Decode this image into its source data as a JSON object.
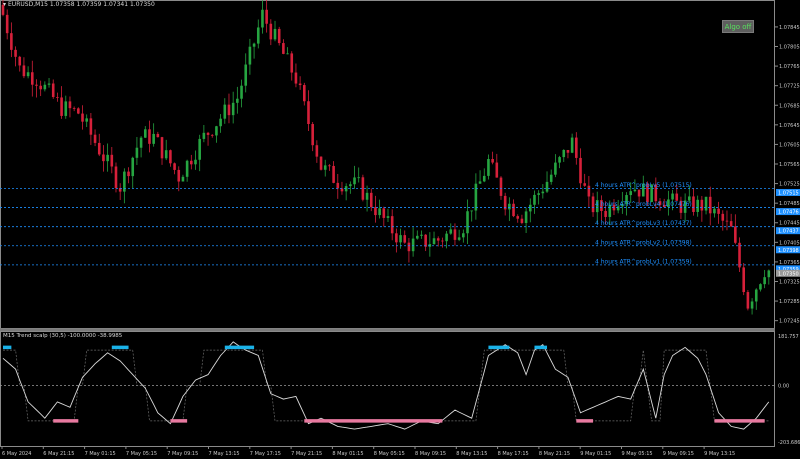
{
  "header": {
    "symbol_line": "EURUSD,M15  1.07358 1.07359 1.07341 1.07350"
  },
  "algo_button": {
    "label": "Algo off"
  },
  "indicator": {
    "title": "M15 Trend scalp (30,5) -100.0000 -38.9985",
    "scale_top": "181.757",
    "scale_zero": "0.00",
    "scale_bottom": "-203.6869"
  },
  "price_axis": {
    "range": [
      1.0723,
      1.079
    ],
    "ticks": [
      {
        "value": 1.07845,
        "label": "1.07845"
      },
      {
        "value": 1.07805,
        "label": "1.07805"
      },
      {
        "value": 1.07765,
        "label": "1.07765"
      },
      {
        "value": 1.07725,
        "label": "1.07725"
      },
      {
        "value": 1.07685,
        "label": "1.07685"
      },
      {
        "value": 1.07645,
        "label": "1.07645"
      },
      {
        "value": 1.07605,
        "label": "1.07605"
      },
      {
        "value": 1.07565,
        "label": "1.07565"
      },
      {
        "value": 1.07525,
        "label": "1.07525"
      },
      {
        "value": 1.07485,
        "label": "1.07485"
      },
      {
        "value": 1.07445,
        "label": "1.07445"
      },
      {
        "value": 1.07405,
        "label": "1.07405"
      },
      {
        "value": 1.07365,
        "label": "1.07365"
      },
      {
        "value": 1.07325,
        "label": "1.07325"
      },
      {
        "value": 1.07285,
        "label": "1.07285"
      },
      {
        "value": 1.07245,
        "label": "1.07245"
      }
    ]
  },
  "time_axis": [
    "6 May 2024",
    "6 May 21:15",
    "7 May 01:15",
    "7 May 05:15",
    "7 May 09:15",
    "7 May 13:15",
    "7 May 17:15",
    "7 May 21:15",
    "8 May 01:15",
    "8 May 05:15",
    "8 May 09:15",
    "8 May 13:15",
    "8 May 17:15",
    "8 May 21:15",
    "9 May 01:15",
    "9 May 05:15",
    "9 May 09:15",
    "9 May 13:15"
  ],
  "levels": [
    {
      "label": "4 hours ATR^probLv5 (1.07515)",
      "value": 1.07515,
      "tag": "1.07515"
    },
    {
      "label": "4 hours ATR^probLv4 (1.07476)",
      "value": 1.07476,
      "tag": "1.07476"
    },
    {
      "label": "4 hours ATR^probLv3 (1.07437)",
      "value": 1.07437,
      "tag": "1.07437"
    },
    {
      "label": "4 hours ATR^probLv2 (1.07398)",
      "value": 1.07398,
      "tag": "1.07398"
    },
    {
      "label": "4 hours ATR^probLv1 (1.07359)",
      "value": 1.07359,
      "tag": "1.07359"
    }
  ],
  "current_price": {
    "value": 1.0735,
    "tag": "1.07350"
  },
  "colors": {
    "bull": "#26a541",
    "bear": "#d6203a",
    "level": "#1e90ff",
    "osc_line": "#d9d9d9",
    "up_segment": "#1ab2e8",
    "down_segment": "#e87aa0",
    "background": "#000000"
  },
  "chart_data": {
    "type": "candlestick",
    "price_key_points": [
      [
        0,
        1.0787
      ],
      [
        4,
        1.0776
      ],
      [
        8,
        1.0774
      ],
      [
        14,
        1.0768
      ],
      [
        18,
        1.0767
      ],
      [
        24,
        1.0758
      ],
      [
        28,
        1.0752
      ],
      [
        33,
        1.0762
      ],
      [
        36,
        1.0762
      ],
      [
        42,
        1.0754
      ],
      [
        48,
        1.0762
      ],
      [
        56,
        1.077
      ],
      [
        62,
        1.0787
      ],
      [
        70,
        1.0774
      ],
      [
        76,
        1.0756
      ],
      [
        80,
        1.0753
      ],
      [
        85,
        1.0752
      ],
      [
        92,
        1.0744
      ],
      [
        96,
        1.074
      ],
      [
        104,
        1.0741
      ],
      [
        110,
        1.0744
      ],
      [
        116,
        1.0757
      ],
      [
        120,
        1.0749
      ],
      [
        124,
        1.0746
      ],
      [
        130,
        1.0753
      ],
      [
        136,
        1.0761
      ],
      [
        140,
        1.0748
      ],
      [
        144,
        1.0747
      ],
      [
        150,
        1.0752
      ],
      [
        156,
        1.075
      ],
      [
        162,
        1.0748
      ],
      [
        168,
        1.0748
      ],
      [
        174,
        1.0743
      ],
      [
        178,
        1.0728
      ],
      [
        182,
        1.0735
      ]
    ],
    "oscillator": {
      "range": [
        -203.6869,
        181.757
      ],
      "key_points": [
        [
          0,
          100
        ],
        [
          3,
          60
        ],
        [
          6,
          -60
        ],
        [
          10,
          -120
        ],
        [
          13,
          -60
        ],
        [
          16,
          -80
        ],
        [
          19,
          30
        ],
        [
          22,
          80
        ],
        [
          25,
          120
        ],
        [
          28,
          90
        ],
        [
          31,
          40
        ],
        [
          34,
          -10
        ],
        [
          37,
          -100
        ],
        [
          40,
          -140
        ],
        [
          43,
          -40
        ],
        [
          46,
          20
        ],
        [
          49,
          40
        ],
        [
          52,
          110
        ],
        [
          55,
          160
        ],
        [
          58,
          130
        ],
        [
          61,
          110
        ],
        [
          64,
          -30
        ],
        [
          67,
          -50
        ],
        [
          70,
          -40
        ],
        [
          73,
          -140
        ],
        [
          76,
          -120
        ],
        [
          80,
          -150
        ],
        [
          84,
          -160
        ],
        [
          88,
          -150
        ],
        [
          92,
          -140
        ],
        [
          96,
          -160
        ],
        [
          100,
          -130
        ],
        [
          104,
          -140
        ],
        [
          108,
          -90
        ],
        [
          112,
          -120
        ],
        [
          116,
          110
        ],
        [
          120,
          150
        ],
        [
          123,
          120
        ],
        [
          125,
          40
        ],
        [
          127,
          130
        ],
        [
          129,
          150
        ],
        [
          132,
          60
        ],
        [
          135,
          30
        ],
        [
          138,
          -100
        ],
        [
          141,
          -80
        ],
        [
          144,
          -60
        ],
        [
          147,
          -40
        ],
        [
          150,
          -50
        ],
        [
          153,
          60
        ],
        [
          156,
          -120
        ],
        [
          158,
          40
        ],
        [
          160,
          110
        ],
        [
          163,
          140
        ],
        [
          166,
          100
        ],
        [
          168,
          40
        ],
        [
          171,
          -100
        ],
        [
          174,
          -150
        ],
        [
          177,
          -160
        ],
        [
          180,
          -120
        ],
        [
          183,
          -60
        ]
      ],
      "up_segments": [
        [
          0,
          2
        ],
        [
          26,
          30
        ],
        [
          53,
          60
        ],
        [
          116,
          121
        ],
        [
          127,
          130
        ]
      ],
      "down_segments": [
        [
          12,
          18
        ],
        [
          40,
          44
        ],
        [
          72,
          105
        ],
        [
          137,
          141
        ],
        [
          170,
          182
        ]
      ]
    }
  }
}
